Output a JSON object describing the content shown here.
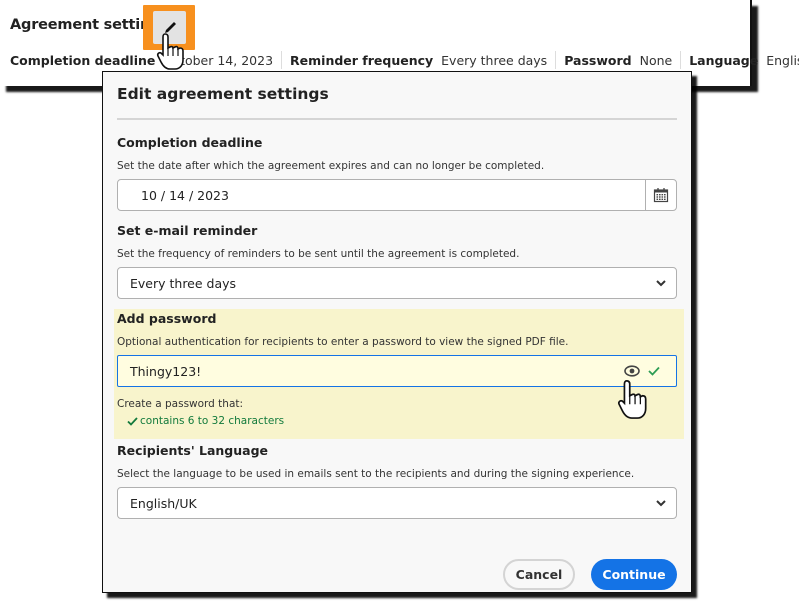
{
  "summary": {
    "title": "Agreement settings",
    "edit_icon": "pencil-icon",
    "items": [
      {
        "label": "Completion deadline",
        "value": "October 14, 2023"
      },
      {
        "label": "Reminder frequency",
        "value": "Every three days"
      },
      {
        "label": "Password",
        "value": "None"
      },
      {
        "label": "Language",
        "value": "English/UK"
      }
    ]
  },
  "dialog": {
    "title": "Edit agreement settings",
    "deadline": {
      "title": "Completion deadline",
      "description": "Set the date after which the agreement expires and can no longer be completed.",
      "value": "10 / 14 / 2023",
      "icon": "calendar-icon"
    },
    "reminder": {
      "title": "Set e-mail reminder",
      "description": "Set the frequency of reminders to be sent until the agreement is completed.",
      "value": "Every three days",
      "icon": "chevron-down-icon"
    },
    "password": {
      "title": "Add password",
      "description": "Optional authentication for recipients to enter a password to view the signed PDF file.",
      "value": "Thingy123!",
      "rules_heading": "Create a password that:",
      "rules": [
        {
          "text": "contains 6 to 32 characters",
          "status": "ok"
        }
      ]
    },
    "language": {
      "title": "Recipients' Language",
      "description": "Select the language to be used in emails sent to the recipients and during the signing experience.",
      "value": "English/UK"
    },
    "buttons": {
      "cancel": "Cancel",
      "continue": "Continue"
    }
  },
  "colors": {
    "accent": "#1473e6",
    "highlight_orange": "#f7901e",
    "password_highlight": "#f8f4cc",
    "success": "#127a3c"
  }
}
